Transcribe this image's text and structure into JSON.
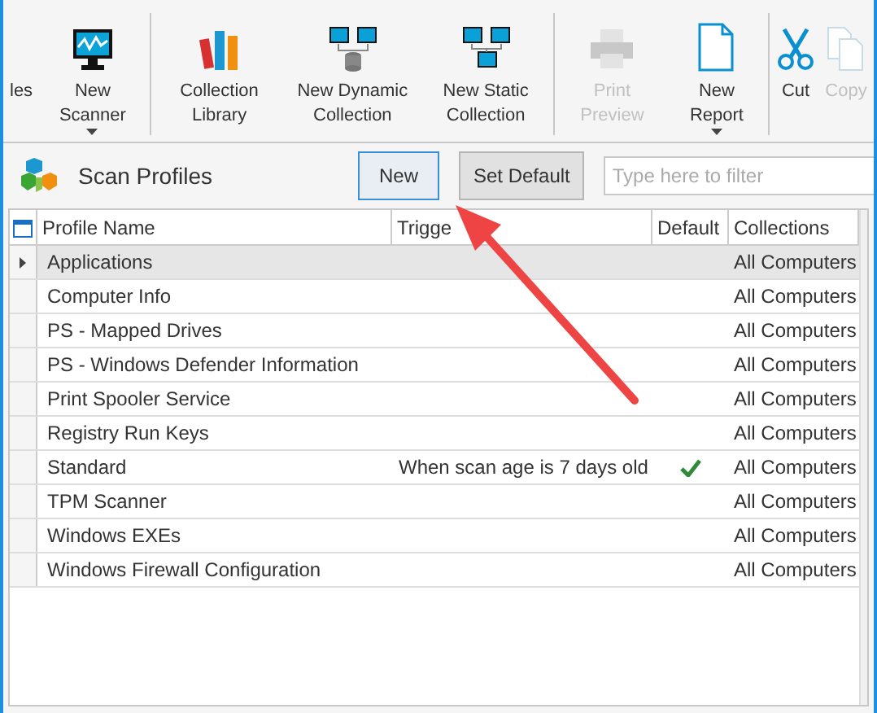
{
  "toolbar": {
    "groups": [
      [
        {
          "label": "les",
          "disabled": false,
          "dropdown": false
        },
        {
          "label": "New Scanner",
          "disabled": false,
          "dropdown": true
        }
      ],
      [
        {
          "label": "Collection Library",
          "disabled": false,
          "dropdown": false
        },
        {
          "label": "New Dynamic Collection",
          "disabled": false,
          "dropdown": false
        },
        {
          "label": "New Static Collection",
          "disabled": false,
          "dropdown": false
        }
      ],
      [
        {
          "label": "Print Preview",
          "disabled": true,
          "dropdown": false
        },
        {
          "label": "New Report",
          "disabled": false,
          "dropdown": true
        }
      ],
      [
        {
          "label": "Cut",
          "disabled": false,
          "dropdown": false
        },
        {
          "label": "Copy",
          "disabled": true,
          "dropdown": false
        }
      ]
    ]
  },
  "panel": {
    "title": "Scan Profiles",
    "buttons": [
      {
        "label": "New",
        "focused": true
      },
      {
        "label": "Set Default",
        "focused": false
      }
    ],
    "filter": {
      "placeholder": "Type here to filter"
    }
  },
  "table": {
    "columns": [
      "Profile Name",
      "Trigge",
      "Default",
      "Collections"
    ],
    "rows": [
      {
        "name": "Applications",
        "trigger": "",
        "default": false,
        "collections": "All Computers",
        "selected": true
      },
      {
        "name": "Computer Info",
        "trigger": "",
        "default": false,
        "collections": "All Computers",
        "selected": false
      },
      {
        "name": "PS - Mapped Drives",
        "trigger": "",
        "default": false,
        "collections": "All Computers",
        "selected": false
      },
      {
        "name": "PS - Windows Defender Information",
        "trigger": "",
        "default": false,
        "collections": "All Computers",
        "selected": false
      },
      {
        "name": "Print Spooler Service",
        "trigger": "",
        "default": false,
        "collections": "All Computers",
        "selected": false
      },
      {
        "name": "Registry Run Keys",
        "trigger": "",
        "default": false,
        "collections": "All Computers",
        "selected": false
      },
      {
        "name": "Standard",
        "trigger": "When scan age is 7 days old",
        "default": true,
        "collections": "All Computers",
        "selected": false
      },
      {
        "name": "TPM Scanner",
        "trigger": "",
        "default": false,
        "collections": "All Computers",
        "selected": false
      },
      {
        "name": "Windows EXEs",
        "trigger": "",
        "default": false,
        "collections": "All Computers",
        "selected": false
      },
      {
        "name": "Windows Firewall Configuration",
        "trigger": "",
        "default": false,
        "collections": "All Computers",
        "selected": false
      }
    ]
  }
}
